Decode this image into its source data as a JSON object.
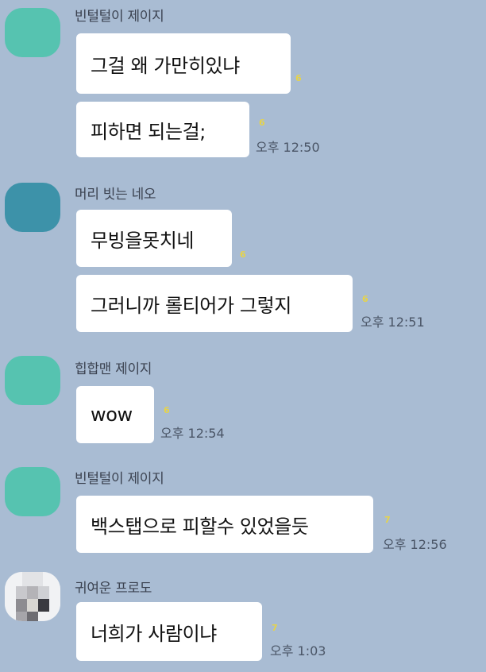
{
  "messages": [
    {
      "sender": "빈털털이 제이지",
      "avatar_color": "#56c3b0",
      "bubbles": [
        {
          "text": "그걸 왜 가만히있냐",
          "unread": "6",
          "time": ""
        },
        {
          "text": "피하면 되는걸;",
          "unread": "6",
          "time": "오후 12:50"
        }
      ]
    },
    {
      "sender": "머리 빗는 네오",
      "avatar_color": "#3d92a9",
      "bubbles": [
        {
          "text": "무빙을못치네",
          "unread": "6",
          "time": ""
        },
        {
          "text": "그러니까 롤티어가 그렇지",
          "unread": "6",
          "time": "오후 12:51"
        }
      ]
    },
    {
      "sender": "힙합맨 제이지",
      "avatar_color": "#56c3b0",
      "bubbles": [
        {
          "text": "wow",
          "unread": "6",
          "time": "오후 12:54"
        }
      ]
    },
    {
      "sender": "빈털털이 제이지",
      "avatar_color": "#56c3b0",
      "bubbles": [
        {
          "text": "백스탭으로 피할수 있었을듯",
          "unread": "7",
          "time": "오후 12:56"
        }
      ]
    },
    {
      "sender": "귀여운 프로도",
      "avatar_color": "#eceef1",
      "bubbles": [
        {
          "text": "너희가 사람이냐",
          "unread": "7",
          "time": "오후 1:03"
        }
      ]
    }
  ]
}
